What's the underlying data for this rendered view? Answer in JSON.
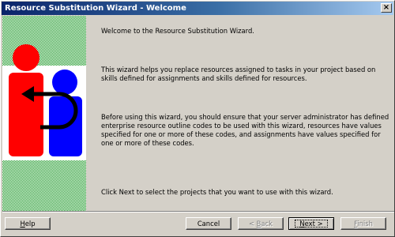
{
  "window": {
    "title": "Resource Substitution Wizard - Welcome",
    "close_glyph": "×"
  },
  "content": {
    "welcome": "Welcome to the Resource Substitution Wizard.",
    "description": "This wizard helps you replace resources assigned to tasks in your project based on skills defined for assignments and skills defined for resources.",
    "prerequisites": "Before using this wizard, you should ensure that your server administrator has defined enterprise resource outline codes to be used with this wizard, resources have values specified for one or more of these codes, and assignments have values specified for one or more of these codes.",
    "instruction": "Click Next to select the projects that you want to use with this wizard."
  },
  "buttons": {
    "help": {
      "mnemonic": "H",
      "rest": "elp",
      "enabled": true
    },
    "cancel": {
      "label": "Cancel",
      "enabled": true
    },
    "back": {
      "prefix": "< ",
      "mnemonic": "B",
      "rest": "ack",
      "enabled": false
    },
    "next": {
      "mnemonic": "N",
      "rest": "ext >",
      "enabled": true,
      "default": true
    },
    "finish": {
      "mnemonic": "F",
      "rest": "inish",
      "enabled": false
    }
  },
  "colors": {
    "title_bar_start": "#0a246a",
    "title_bar_end": "#a6caf0",
    "art_green": "#1f9a2a",
    "person_red": "#ff0000",
    "person_blue": "#0000ff"
  }
}
